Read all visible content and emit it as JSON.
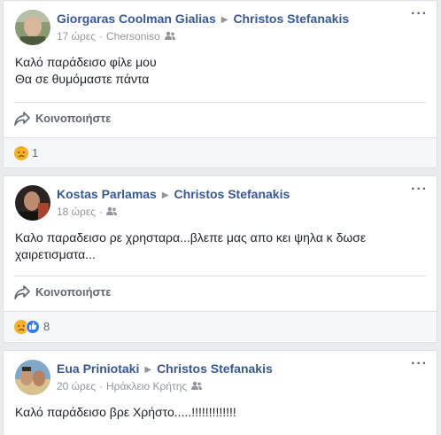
{
  "posts": [
    {
      "author": "Giorgaras Coolman Gialias",
      "target": "Christos Stefanakis",
      "time": "17 ώρες",
      "location": "Chersoniso",
      "lines": [
        "Καλό παράδεισο φίλε μου",
        "Θα σε θυμόμαστε πάντα"
      ],
      "share_label": "Κοινοποιήστε",
      "reaction_count": "1"
    },
    {
      "author": "Kostas Parlamas",
      "target": "Christos Stefanakis",
      "time": "18 ώρες",
      "lines": [
        "Καλο παραδεισο ρε χρησταρα...βλεπε μας απο κει ψηλα κ δωσε",
        "χαιρετισματα..."
      ],
      "share_label": "Κοινοποιήστε",
      "reaction_count": "8"
    },
    {
      "author": "Eua Priniotaki",
      "target": "Christos Stefanakis",
      "time": "20 ώρες",
      "location": "Ηράκλειο Κρήτης",
      "lines": [
        "Καλό παράδεισο βρε Χρήστο.....!!!!!!!!!!!!!"
      ]
    }
  ],
  "colors": {
    "link": "#365899",
    "meta": "#90949c",
    "background": "#e9ebee"
  },
  "icons": {
    "privacy": "friends-icon",
    "share": "share-arrow-icon",
    "more": "more-options-icon",
    "sad": "sad-reaction-icon",
    "like": "like-reaction-icon"
  }
}
